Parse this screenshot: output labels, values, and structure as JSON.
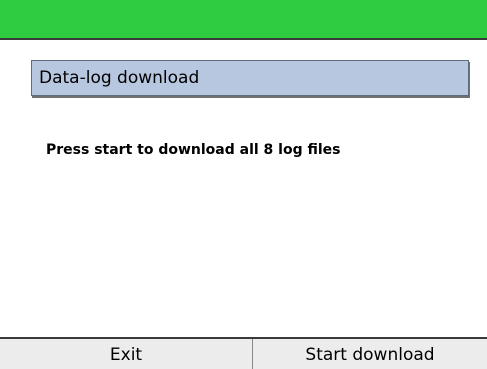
{
  "header": {
    "color": "#2ecc40"
  },
  "dialog": {
    "title": "Data-log download",
    "message": "Press start to download all 8 log files"
  },
  "softkeys": {
    "left_label": "Exit",
    "right_label": "Start download"
  },
  "colors": {
    "title_box": "#b7c7df",
    "softkey_bar": "#ececec"
  }
}
